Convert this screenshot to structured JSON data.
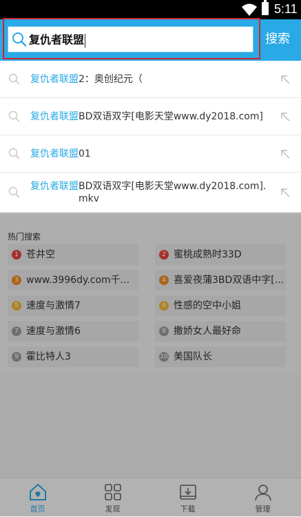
{
  "status_bar": {
    "time": "5:11"
  },
  "search": {
    "query": "复仇者联盟",
    "button_label": "搜索"
  },
  "suggestions": [
    {
      "keyword": "复仇者联盟",
      "rest": "2：奥创纪元（"
    },
    {
      "keyword": "复仇者联盟",
      "rest": "BD双语双字[电影天堂www.dy2018.com]"
    },
    {
      "keyword": "复仇者联盟",
      "rest": "01"
    },
    {
      "keyword": "复仇者联盟",
      "rest": "BD双语双字[电影天堂www.dy2018.com].mkv"
    }
  ],
  "hot": {
    "title": "热门搜索",
    "items": [
      {
        "num": "1",
        "text": "苍井空",
        "color": "#e0463c"
      },
      {
        "num": "2",
        "text": "蜜桃成熟时33D",
        "color": "#e0463c"
      },
      {
        "num": "3",
        "text": "www.3996dy.com千...",
        "color": "#f08a24"
      },
      {
        "num": "4",
        "text": "喜爱夜蒲3BD双语中字[...",
        "color": "#f08a24"
      },
      {
        "num": "5",
        "text": "速度与激情7",
        "color": "#f2b632"
      },
      {
        "num": "6",
        "text": "性感的空中小姐",
        "color": "#f2b632"
      },
      {
        "num": "7",
        "text": "速度与激情6",
        "color": "#9a9a9a"
      },
      {
        "num": "8",
        "text": "撒娇女人最好命",
        "color": "#9a9a9a"
      },
      {
        "num": "9",
        "text": "霍比特人3",
        "color": "#9a9a9a"
      },
      {
        "num": "10",
        "text": "美国队长",
        "color": "#9a9a9a"
      }
    ]
  },
  "nav": [
    {
      "label": "首页",
      "icon": "home-icon",
      "active": true
    },
    {
      "label": "发现",
      "icon": "grid-icon",
      "active": false
    },
    {
      "label": "下载",
      "icon": "download-icon",
      "active": false
    },
    {
      "label": "管理",
      "icon": "user-icon",
      "active": false
    }
  ],
  "colors": {
    "accent": "#29a9e5",
    "highlight_border": "#d2232a"
  }
}
